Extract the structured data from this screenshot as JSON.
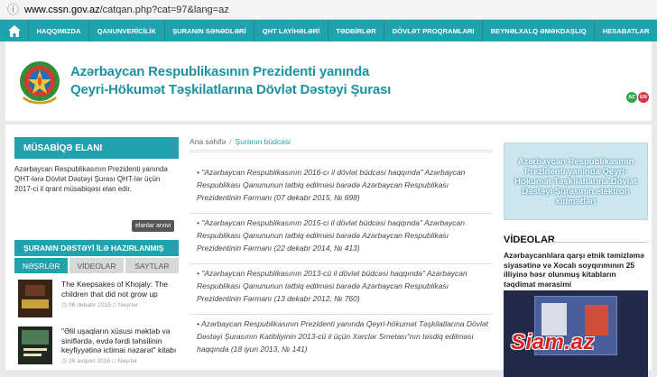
{
  "browser": {
    "url_prefix": "www.cssn.gov.az",
    "url_path": "/catqan.php?cat=97&lang=az"
  },
  "nav": {
    "items": [
      "HAQQIMIZDA",
      "QANUNVERİCİLİK",
      "ŞURANIN SƏNƏDLƏRİ",
      "QHT LAYİHƏLƏRİ",
      "TƏDBİRLƏR",
      "DÖVLƏT PROQRAMLARI",
      "BEYNƏLXALQ ƏMƏKDAŞLIQ",
      "HESABATLAR"
    ],
    "colors": {
      "bar": "#22a2ad"
    }
  },
  "header": {
    "title_line1": "Azərbaycan Respublikasının Prezidenti yanında",
    "title_line2": "Qeyri-Hökumət Təşkilatlarına Dövlət Dəstəyi Şurası",
    "lang_az": "AZ",
    "lang_en": "EN"
  },
  "sidebar": {
    "contest_title": "MÜSABİQƏ ELANI",
    "contest_text": "Azərbaycan Respublikasının Prezidenti yanında QHT-lərə Dövlət Dəstəyi Şurası QHT-lər üçün 2017-ci il qrant müsabiqəsi elan edir.",
    "archive_button": "elanlar arxivi",
    "prepared_title": "ŞURANIN DƏSTƏYİ İLƏ HAZIRLANMIŞ",
    "tabs": [
      "NƏŞRLƏR",
      "VİDEOLAR",
      "SAYTLAR"
    ],
    "news": [
      {
        "title": "The Keepsakes of Khojaly: The children that did not grow up",
        "date": "06 dekabr 2015",
        "category": "Nəşrlər"
      },
      {
        "title": "\"Əlil uşaqların xüsusi məktəb və siniflərdə, evdə fərdi təhsilinin keyfiyyətinə ictimai nəzarət\" kitabı",
        "date": "29 avqust 2016",
        "category": "Nəşrlər"
      }
    ]
  },
  "breadcrumb": {
    "home": "Ana səhifə",
    "separator": "/",
    "current": "Şuranın büdcəsi"
  },
  "articles": [
    "• \"Azərbaycan Respublikasının 2016-cı il dövlət büdcəsi haqqında\" Azərbaycan Respublikası Qanununun tətbiq edilməsi barədə Azərbaycan Respublikası Prezidentinin Fərmanı (07 dekabr 2015, № 698)",
    "• \"Azərbaycan Respublikasının 2015-ci il dövlət büdcəsi haqqında\" Azərbaycan Respublikası Qanununun tətbiq edilməsi barədə Azərbaycan Respublikası Prezidentinin Fərmanı (22 dekabr 2014, № 413)",
    "• \"Azərbaycan Respublikasının 2013-cü il dövlət büdcəsi haqqında\" Azərbaycan Respublikası Qanununun tətbiq edilməsi barədə Azərbaycan Respublikası Prezidentinin Fərmanı (13 dekabr 2012, № 760)",
    "• Azərbaycan Respublikasının Prezidenti yanında Qeyri-hökumət Təşkilatlarına Dövlət Dəstəyi Şurasının Katibliyinin 2013-cü il üçün Xərclər Smetası\"nın təsdiq edilməsi haqqında (18 iyun 2013, № 141)"
  ],
  "right": {
    "banner_text": "Azərbaycan Respublikasının Prezidenti yanında Qeyri-Hökumət Təşkilatlarına Dövlət Dəstəyi Şurasının elektron xidmətləri",
    "videos_title": "VİDEOLAR",
    "video_caption": "Azərbaycanlılara qarşı etnik təmizləmə siyasətinə və Xocalı soyqırımının 25 illiyinə həsr olunmuş kitabların təqdimat mərasimi"
  },
  "watermark": "Siam.az"
}
